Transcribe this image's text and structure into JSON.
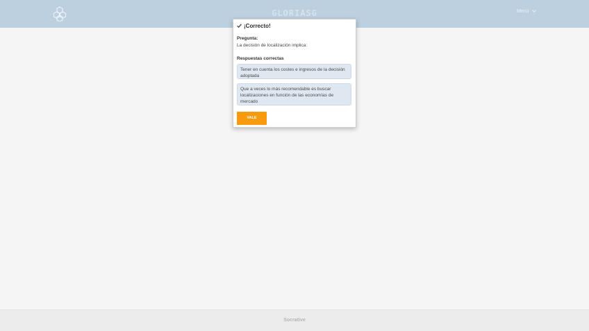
{
  "header": {
    "room_name": "GLORIASG",
    "user_label": "Menú",
    "logo_icon": "hexagon-cluster-logo"
  },
  "modal": {
    "title": "¡Correcto!",
    "title_icon": "checkmark-icon",
    "question_label": "Pregunta:",
    "question_text": "La decisión de localización implica:",
    "answers_label": "Respuestas correctas",
    "answers": [
      "Tener en cuenta los costes e ingresos de la decisión adoptada",
      "Que a veces lo más recomendable es buscar localizaciones en función de las economías de mercado"
    ],
    "ok_label": "VALE"
  },
  "footer": {
    "text": "Socrative"
  },
  "colors": {
    "header_bg": "#bdd0df",
    "accent": "#f79a0e",
    "answer_bg": "#dfe8f1",
    "page_bg": "#f5f5f5"
  }
}
